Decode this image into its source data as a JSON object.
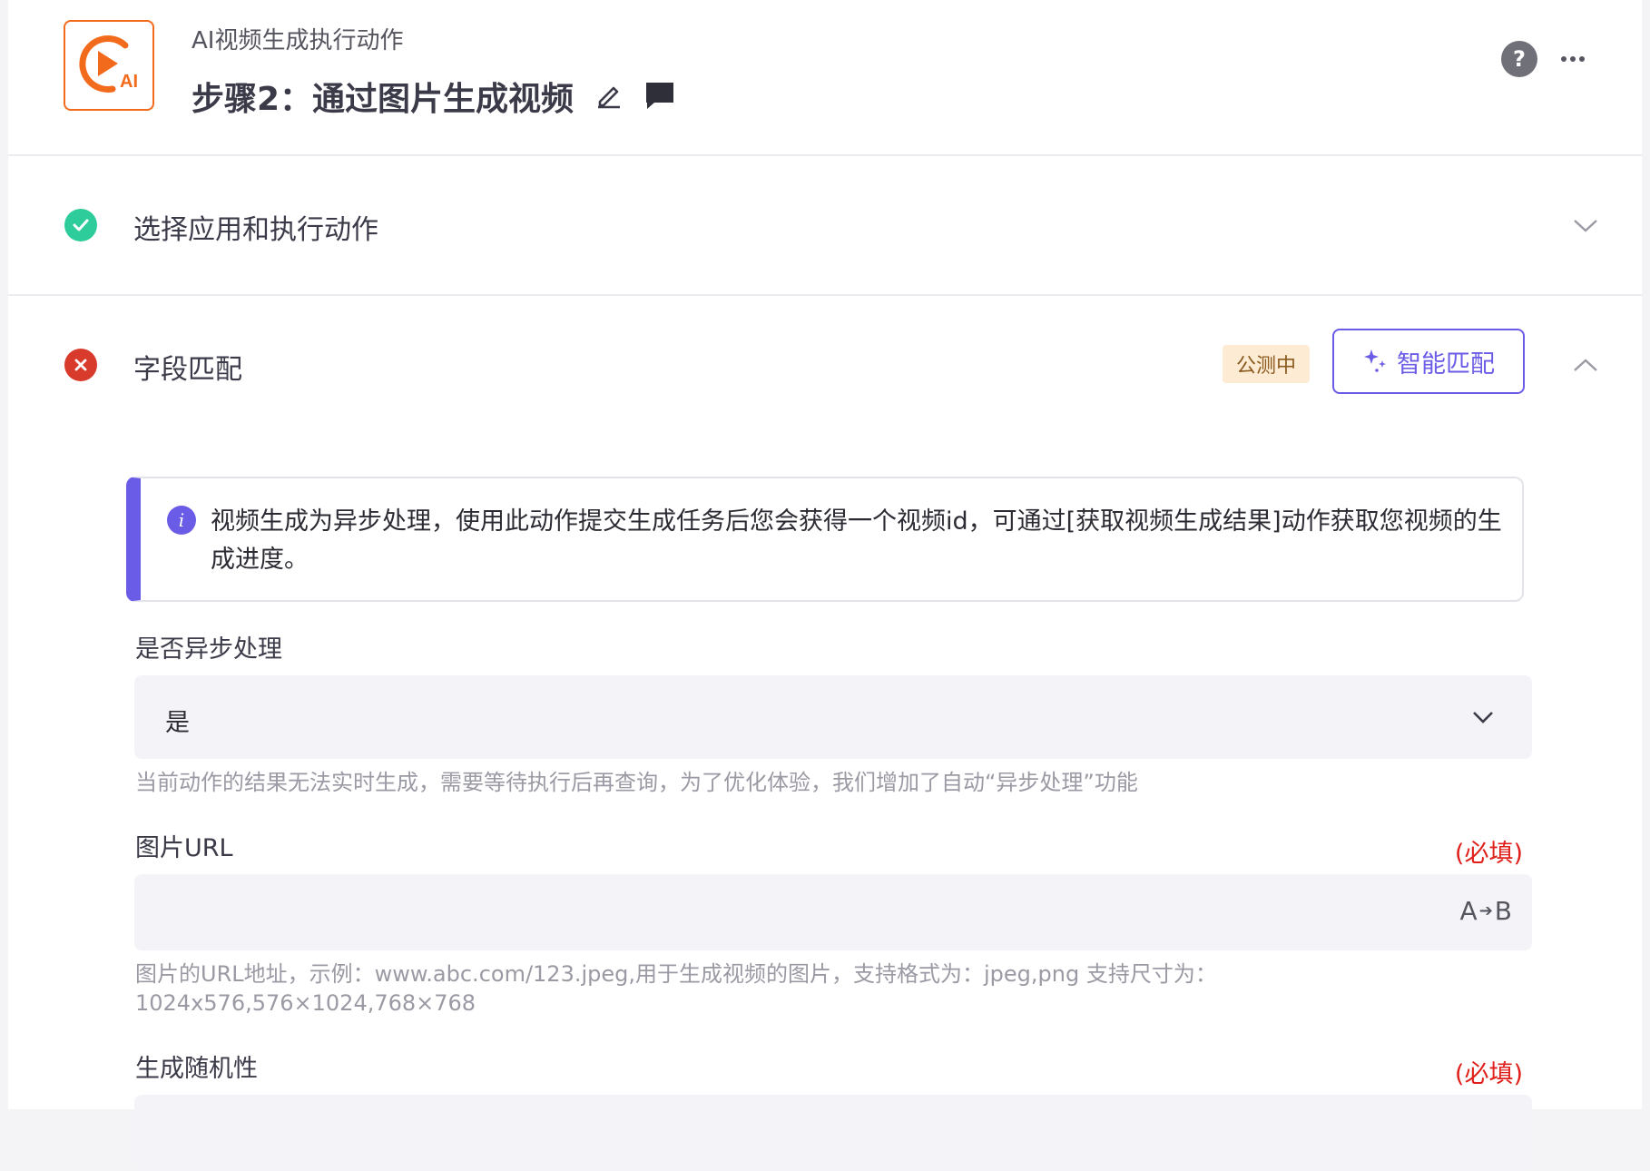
{
  "header": {
    "app_name": "AI视频生成执行动作",
    "step_title": "步骤2：通过图片生成视频",
    "logo_text": "AI",
    "help_symbol": "?",
    "icons": [
      "edit-icon",
      "comment-icon",
      "help-icon",
      "more-icon"
    ]
  },
  "sections": {
    "select_app": {
      "title": "选择应用和执行动作",
      "status": "complete"
    },
    "field_match": {
      "title": "字段匹配",
      "status": "error",
      "badge": "公测中",
      "smart_match_label": "智能匹配"
    }
  },
  "info": {
    "text": "视频生成为异步处理，使用此动作提交生成任务后您会获得一个视频id，可通过[获取视频生成结果]动作获取您视频的生成进度。",
    "icon_symbol": "i"
  },
  "fields": {
    "async": {
      "label": "是否异步处理",
      "value": "是",
      "hint": "当前动作的结果无法实时生成，需要等待执行后再查询，为了优化体验，我们增加了自动“异步处理”功能"
    },
    "image_url": {
      "label": "图片URL",
      "required": "(必填)",
      "value": "",
      "hint": "图片的URL地址，示例：www.abc.com/123.jpeg,用于生成视频的图片，支持格式为：jpeg,png 支持尺寸为：1024x576,576×1024,768×768",
      "transform_a": "A",
      "transform_b": "B"
    },
    "randomness": {
      "label": "生成随机性",
      "required": "(必填)"
    }
  },
  "colors": {
    "accent": "#6b5ce7",
    "brand_orange": "#f26b1d",
    "success": "#2ecc9a",
    "error": "#d83a2b",
    "required": "#e0201a"
  }
}
